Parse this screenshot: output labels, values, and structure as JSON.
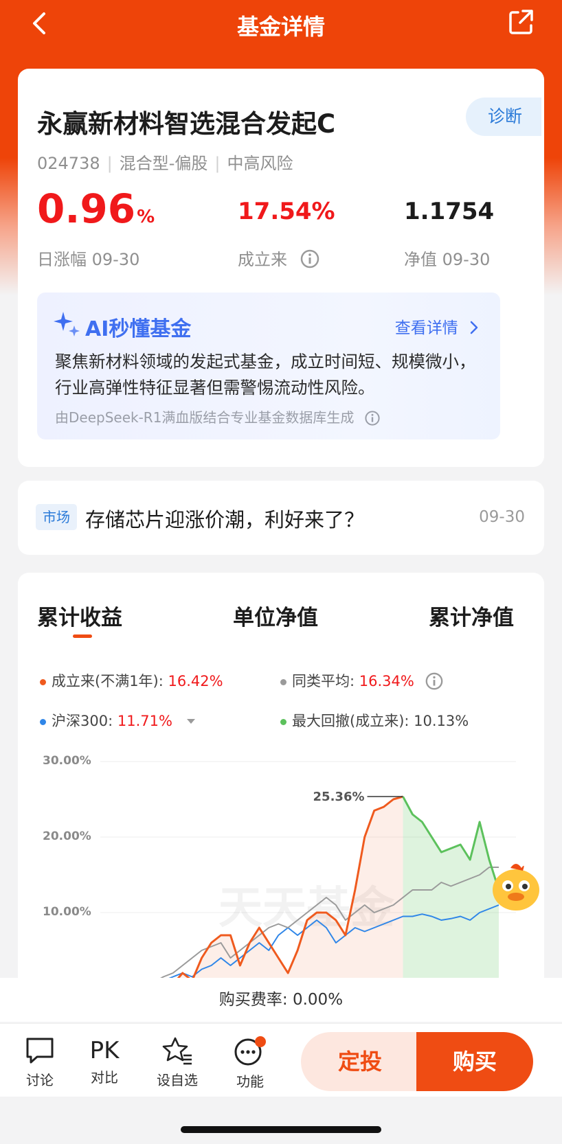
{
  "header": {
    "title": "基金详情"
  },
  "fund": {
    "name": "永赢新材料智选混合发起C",
    "diagnose_label": "诊断",
    "code": "024738",
    "type": "混合型-偏股",
    "risk": "中高风险",
    "daily_change": "0.96",
    "daily_change_unit": "%",
    "daily_change_label": "日涨幅 09-30",
    "since_inception": "17.54%",
    "since_inception_label": "成立来",
    "nav": "1.1754",
    "nav_label": "净值 09-30"
  },
  "ai": {
    "title": "AI秒懂基金",
    "more_label": "查看详情",
    "text": "聚焦新材料领域的发起式基金，成立时间短、规模微小，行业高弹性特征显著但需警惕流动性风险。",
    "source": "由DeepSeek-R1满血版结合专业基金数据库生成"
  },
  "news": {
    "tag": "市场",
    "title": "存储芯片迎涨价潮，利好来了？",
    "date": "09-30"
  },
  "chart_tabs": [
    "累计收益",
    "单位净值",
    "累计净值"
  ],
  "legend": {
    "fund_label": "成立来(不满1年):",
    "fund_value": "16.42%",
    "peer_label": "同类平均:",
    "peer_value": "16.34%",
    "index_label": "沪深300:",
    "index_value": "11.71%",
    "drawdown_label": "最大回撤(成立来):",
    "drawdown_value": "10.13%"
  },
  "chart_data": {
    "type": "line",
    "y_ticks": [
      "30.00%",
      "20.00%",
      "10.00%"
    ],
    "ylim": [
      0,
      30
    ],
    "peak_annotation": "25.36%",
    "watermark": "天天基金",
    "series": [
      {
        "name": "成立来(不满1年)",
        "color": "#ef5a1e",
        "values": [
          0,
          0.5,
          1,
          -1,
          0.5,
          2,
          1,
          4,
          6,
          7,
          7,
          3,
          6,
          8,
          6,
          4,
          2,
          5,
          9,
          10,
          10,
          9,
          7,
          13,
          20,
          23.5,
          24,
          25,
          25.36,
          23,
          22,
          20,
          18,
          18.5,
          19,
          17,
          22,
          17,
          13
        ]
      },
      {
        "name": "同类平均",
        "color": "#9a9a9a",
        "values": [
          0,
          0.4,
          0.8,
          1.5,
          2,
          3,
          4,
          5,
          5.5,
          6,
          4,
          5,
          6,
          7,
          8,
          8.5,
          8,
          9,
          10,
          11,
          12,
          11,
          9,
          10,
          11,
          10,
          10.5,
          11,
          12,
          13,
          13,
          13,
          14,
          13.5,
          14,
          14.5,
          15,
          16,
          16
        ]
      },
      {
        "name": "沪深300",
        "color": "#2f86e8",
        "values": [
          0,
          0.2,
          0.5,
          1,
          1.5,
          2,
          1.5,
          2.5,
          3,
          4,
          3,
          4,
          5,
          6,
          5,
          7,
          8,
          7,
          8,
          9,
          8,
          6,
          7,
          8,
          7.5,
          8,
          8.5,
          9,
          9.5,
          9.5,
          9.8,
          9.5,
          9,
          9.2,
          9.5,
          9,
          10,
          10.5,
          11
        ]
      }
    ]
  },
  "fee": {
    "label": "购买费率:",
    "value": "0.00%"
  },
  "bottom_nav": [
    {
      "label": "讨论"
    },
    {
      "label": "对比",
      "icon_text": "PK"
    },
    {
      "label": "设自选"
    },
    {
      "label": "功能"
    }
  ],
  "actions": {
    "sip": "定投",
    "buy": "购买"
  },
  "colors": {
    "brand": "#ef4c13",
    "rise": "#f0191b",
    "link": "#2a7ad8",
    "drawdown_dot": "#5cc15c"
  }
}
